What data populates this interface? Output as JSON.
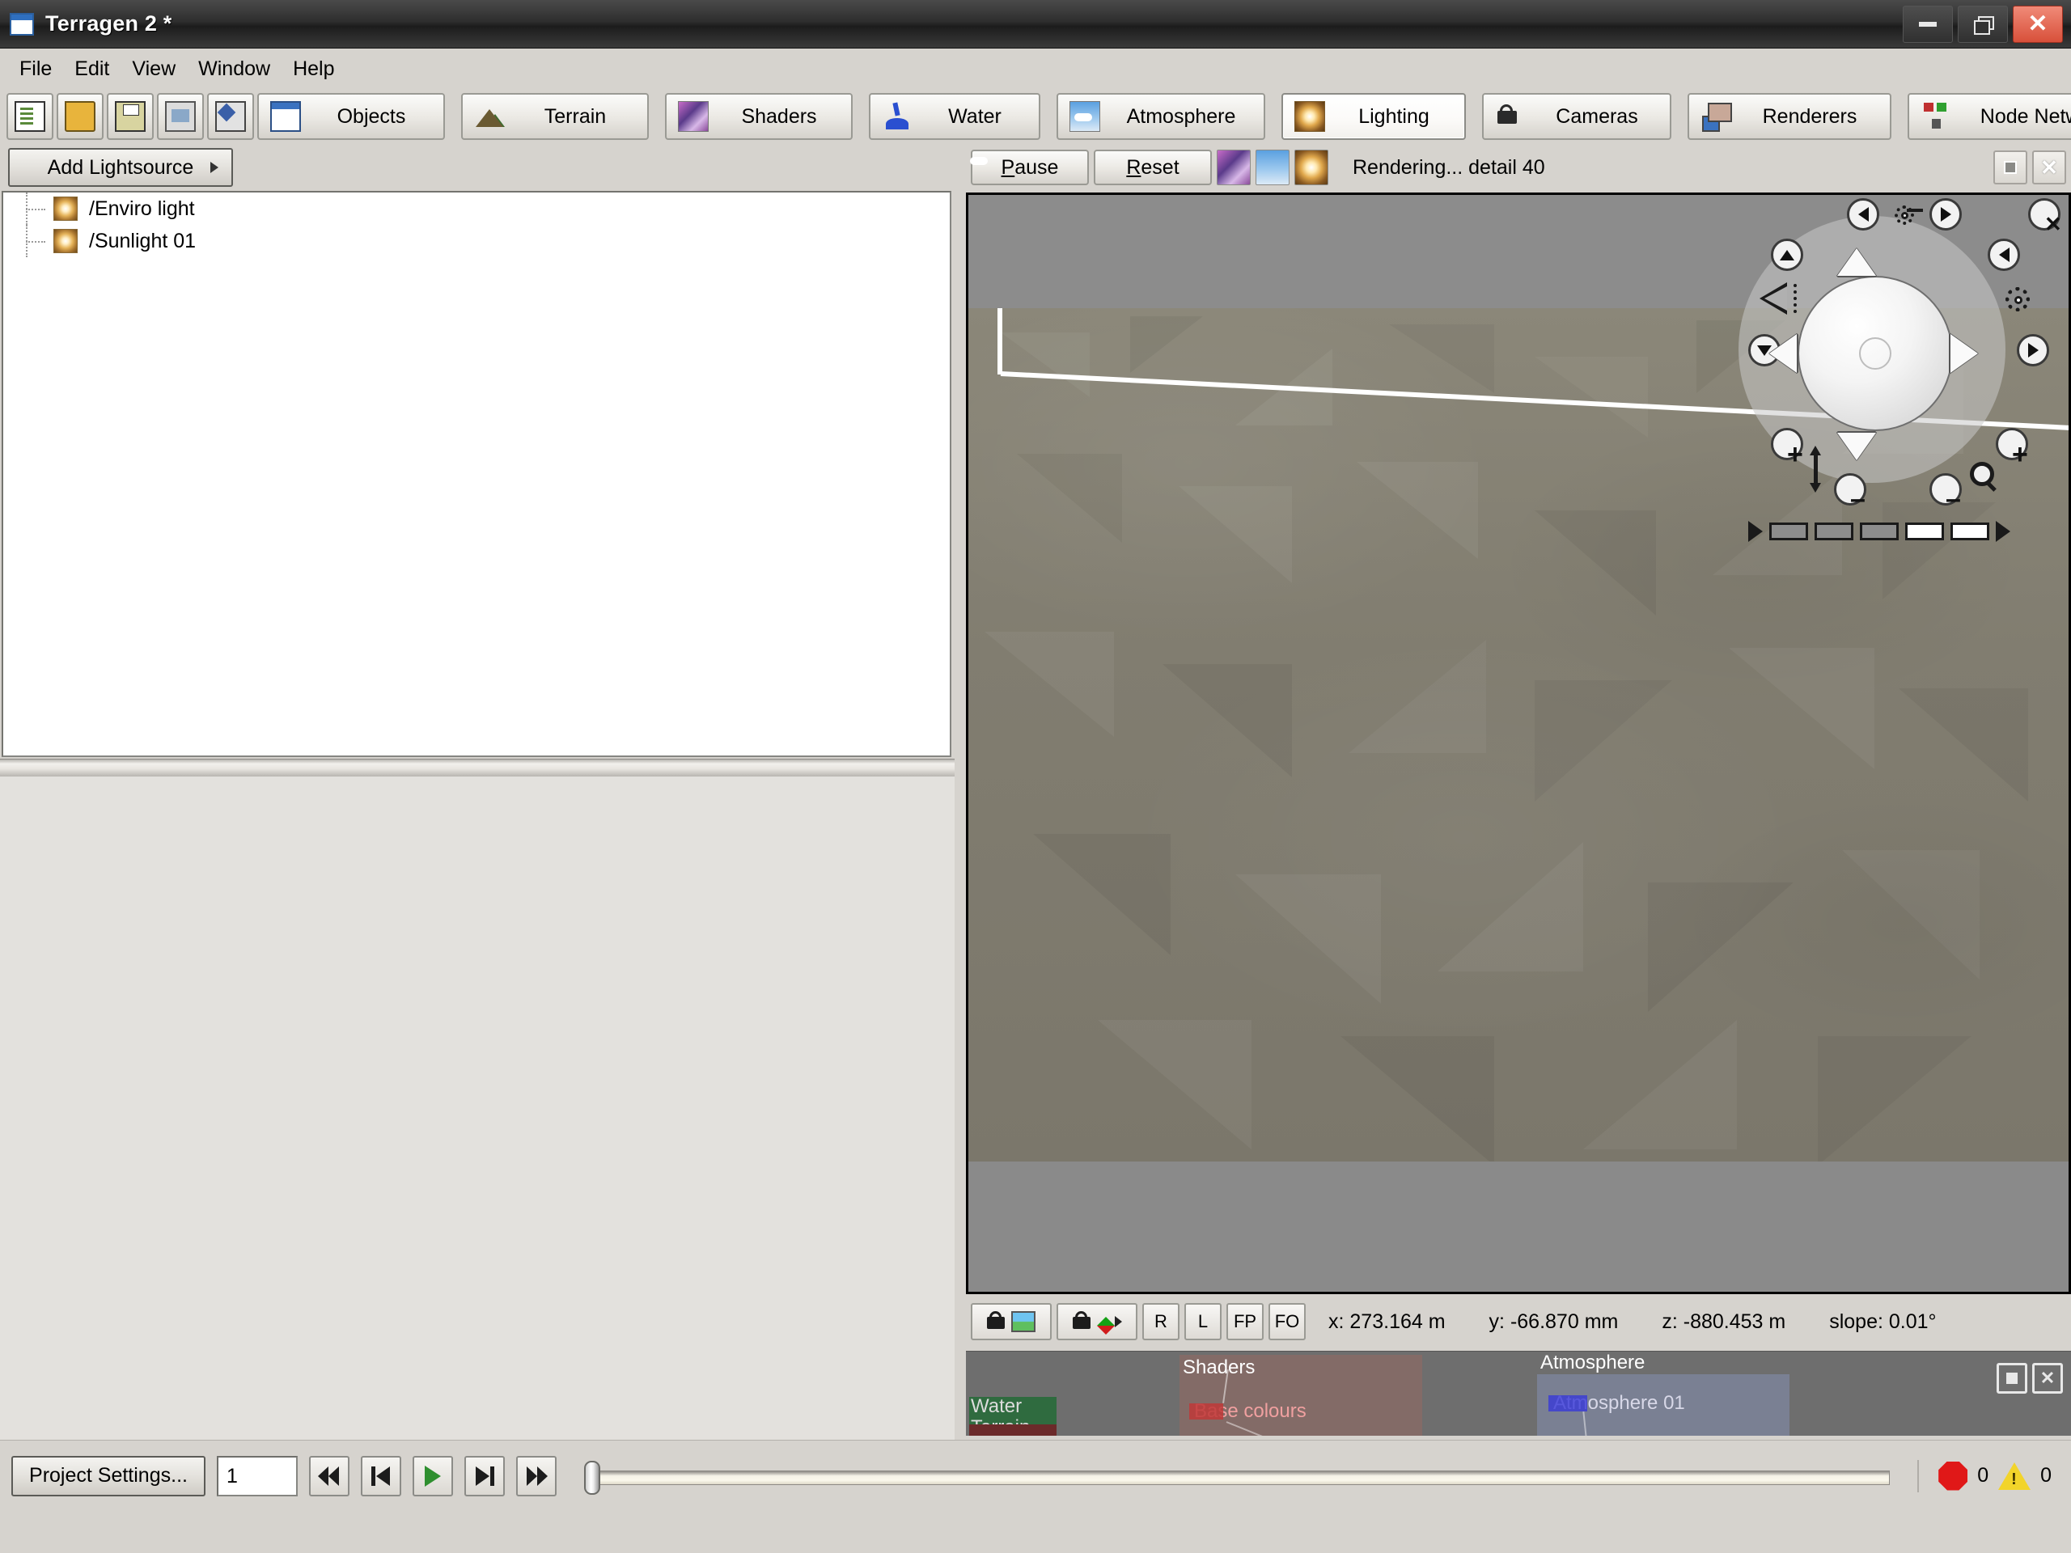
{
  "window": {
    "title": "Terragen 2 *",
    "icon": "app-window-icon",
    "minimize_label": "Minimize",
    "restore_label": "Restore",
    "close_label": "Close"
  },
  "menubar": {
    "items": [
      {
        "label": "File"
      },
      {
        "label": "Edit"
      },
      {
        "label": "View"
      },
      {
        "label": "Window"
      },
      {
        "label": "Help"
      }
    ]
  },
  "toolbar": {
    "icon_buttons": [
      {
        "name": "new-project-icon",
        "title": "New"
      },
      {
        "name": "open-project-icon",
        "title": "Open"
      },
      {
        "name": "save-project-icon",
        "title": "Save"
      },
      {
        "name": "snapshot-icon",
        "title": "Snapshot"
      },
      {
        "name": "paint-icon",
        "title": "Paint"
      }
    ],
    "tabs": [
      {
        "label": "Objects",
        "icon": "objects-icon",
        "active": false
      },
      {
        "label": "Terrain",
        "icon": "terrain-icon",
        "active": false
      },
      {
        "label": "Shaders",
        "icon": "shaders-icon",
        "active": false
      },
      {
        "label": "Water",
        "icon": "water-icon",
        "active": false
      },
      {
        "label": "Atmosphere",
        "icon": "atmosphere-icon",
        "active": false
      },
      {
        "label": "Lighting",
        "icon": "lighting-icon",
        "active": true
      },
      {
        "label": "Cameras",
        "icon": "camera-icon",
        "active": false
      },
      {
        "label": "Renderers",
        "icon": "renderer-icon",
        "active": false
      },
      {
        "label": "Node Network",
        "icon": "node-network-icon",
        "active": false
      }
    ]
  },
  "left_panel": {
    "add_button_label": "Add Lightsource",
    "tree_items": [
      {
        "label": "/Enviro light",
        "icon": "light-node-icon"
      },
      {
        "label": "/Sunlight 01",
        "icon": "light-node-icon"
      }
    ]
  },
  "render_panel": {
    "pause_label": "Pause",
    "pause_accel": "P",
    "reset_label": "Reset",
    "reset_accel": "R",
    "status": "Rendering... detail 40",
    "quick_icons": [
      {
        "name": "shaders-preview-icon"
      },
      {
        "name": "atmosphere-preview-icon"
      },
      {
        "name": "lighting-preview-icon"
      }
    ],
    "maximize_label": "Maximize panel",
    "close_label": "Close panel"
  },
  "navigation_widget": {
    "close_label": "Close navigation widget",
    "orbit_label": "orbit-icon",
    "pan_left_label": "pan-left-icon",
    "pan_right_label": "pan-right-icon",
    "tilt_up_label": "tilt-up-icon",
    "tilt_down_label": "tilt-down-icon",
    "rotate_left_label": "rotate-left-icon",
    "rotate_right_label": "rotate-right-icon",
    "target_label": "target-icon",
    "fov_in_label": "fov-increase-icon",
    "fov_out_label": "fov-decrease-icon",
    "elevation_label": "elevation-arrow-icon",
    "zoom_label": "magnifier-icon",
    "speed_segments": [
      true,
      true,
      true,
      false,
      false
    ]
  },
  "viewport_status": {
    "buttons": [
      {
        "name": "camera-view-toggle",
        "label": ""
      },
      {
        "name": "camera-gizmo-toggle",
        "label": ""
      },
      {
        "name": "rotate-mode-button",
        "label": "R"
      },
      {
        "name": "light-mode-button",
        "label": "L"
      },
      {
        "name": "first-person-button",
        "label": "FP"
      },
      {
        "name": "fly-orbit-button",
        "label": "FO"
      }
    ],
    "coords": [
      {
        "label": "x:",
        "value": "273.164 m"
      },
      {
        "label": "y:",
        "value": "-66.870 mm"
      },
      {
        "label": "z:",
        "value": "-880.453 m"
      },
      {
        "label": "slope:",
        "value": "0.01°"
      }
    ]
  },
  "node_preview": {
    "groups": [
      {
        "title": "Water",
        "subtitle": "Terrain",
        "color": "#2f6b3f"
      },
      {
        "title": "Shaders",
        "node": "Base colours",
        "color": "#8a6a62"
      },
      {
        "title": "Atmosphere",
        "node": "Atmosphere 01",
        "color": "#7f87a0"
      }
    ],
    "maximize_label": "Maximize",
    "close_label": "Close"
  },
  "bottom_bar": {
    "project_settings_label": "Project Settings...",
    "frame_value": "1",
    "playback": [
      {
        "name": "first-frame-button"
      },
      {
        "name": "prev-frame-button"
      },
      {
        "name": "play-button"
      },
      {
        "name": "next-frame-button"
      },
      {
        "name": "last-frame-button"
      }
    ],
    "error_count": "0",
    "warning_count": "0"
  },
  "colors": {
    "chrome": "#d6d3ce",
    "titlebar": "#2e2e2e",
    "accent_close": "#d8503a",
    "error": "#e01818",
    "warning": "#f2d42a",
    "play": "#2f8f2f"
  }
}
